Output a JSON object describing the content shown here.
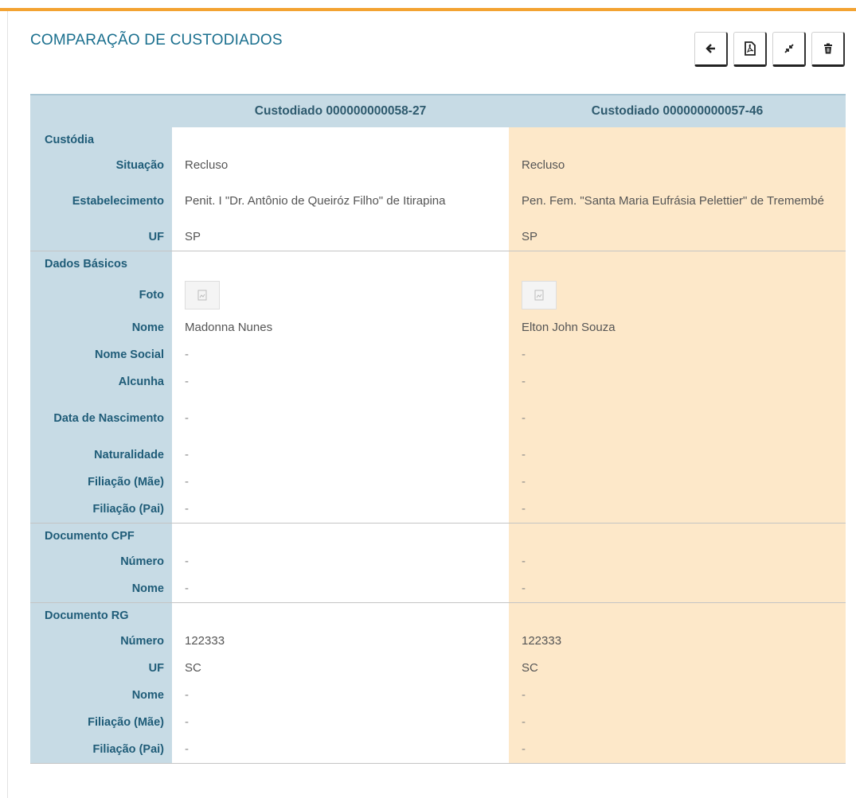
{
  "page_title": "COMPARAÇÃO DE CUSTODIADOS",
  "toolbar": {
    "back_icon": "arrow-left-icon",
    "pdf_icon": "file-pdf-icon",
    "merge_icon": "compress-icon",
    "delete_icon": "trash-icon"
  },
  "colors": {
    "accent_bar": "#f3a332",
    "header_bg": "#c7dbe5",
    "highlight_bg": "#fde8c9",
    "title": "#1a6f8e"
  },
  "columns": [
    "Custodiado 000000000058-27",
    "Custodiado 000000000057-46"
  ],
  "sections": {
    "custodia": {
      "title": "Custódia",
      "rows": [
        {
          "label": "Situação",
          "v1": "Recluso",
          "v2": "Recluso"
        },
        {
          "label": "Estabelecimento",
          "v1": "Penit. I \"Dr. Antônio de Queiróz Filho\" de Itirapina",
          "v2": "Pen. Fem. \"Santa Maria Eufrásia Pelettier\" de Tremembé"
        },
        {
          "label": "UF",
          "v1": "SP",
          "v2": "SP"
        }
      ]
    },
    "dados": {
      "title": "Dados Básicos",
      "foto_label": "Foto",
      "rows": [
        {
          "label": "Nome",
          "v1": "Madonna Nunes",
          "v2": "Elton John Souza"
        },
        {
          "label": "Nome Social",
          "v1": "-",
          "v2": "-"
        },
        {
          "label": "Alcunha",
          "v1": "-",
          "v2": "-"
        },
        {
          "label": "Data de Nascimento",
          "v1": "-",
          "v2": "-"
        },
        {
          "label": "Naturalidade",
          "v1": "-",
          "v2": "-"
        },
        {
          "label": "Filiação (Mãe)",
          "v1": "-",
          "v2": "-"
        },
        {
          "label": "Filiação (Pai)",
          "v1": "-",
          "v2": "-"
        }
      ]
    },
    "cpf": {
      "title": "Documento CPF",
      "rows": [
        {
          "label": "Número",
          "v1": "-",
          "v2": "-"
        },
        {
          "label": "Nome",
          "v1": "-",
          "v2": "-"
        }
      ]
    },
    "rg": {
      "title": "Documento RG",
      "rows": [
        {
          "label": "Número",
          "v1": "122333",
          "v2": "122333"
        },
        {
          "label": "UF",
          "v1": "SC",
          "v2": "SC"
        },
        {
          "label": "Nome",
          "v1": "-",
          "v2": "-"
        },
        {
          "label": "Filiação (Mãe)",
          "v1": "-",
          "v2": "-"
        },
        {
          "label": "Filiação (Pai)",
          "v1": "-",
          "v2": "-"
        }
      ]
    }
  }
}
